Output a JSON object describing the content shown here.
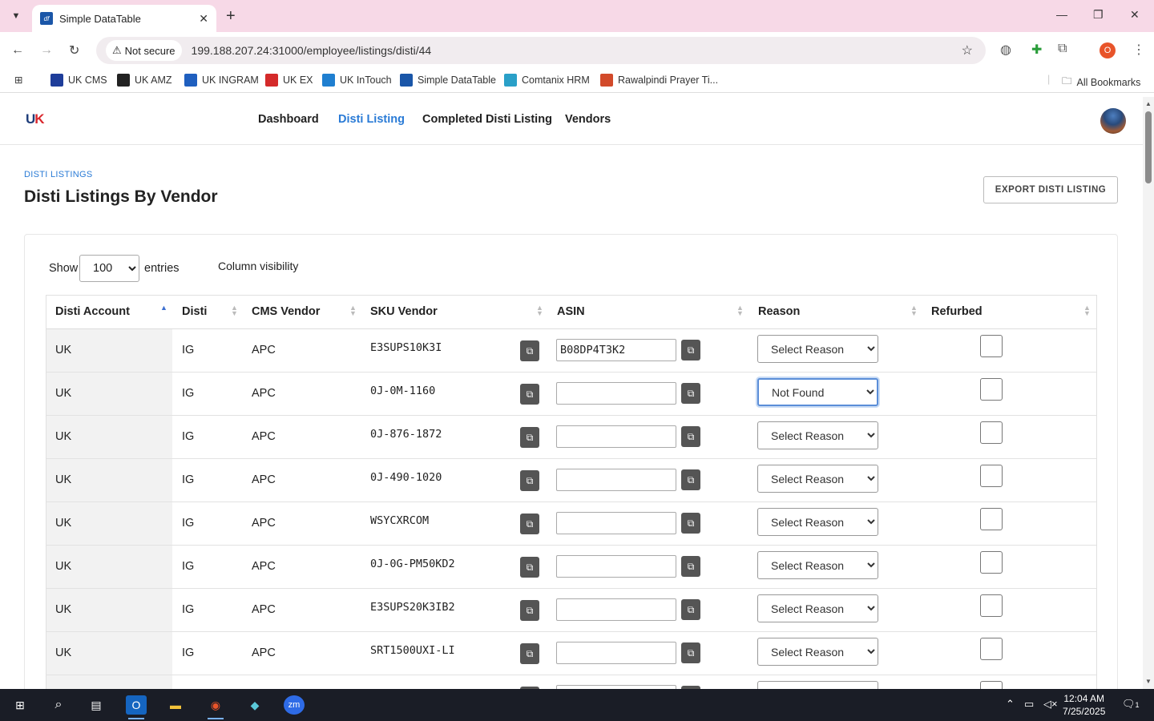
{
  "browser": {
    "tab_title": "Simple DataTable",
    "tab_favicon": "df",
    "security_label": "Not secure",
    "url": "199.188.207.24:31000/employee/listings/disti/44",
    "profile_initial": "O",
    "bookmarks": [
      {
        "label": "UK CMS",
        "color": "#1e3d9a",
        "icon": "uk-cms-icon"
      },
      {
        "label": "UK AMZ",
        "color": "#222222",
        "icon": "amazon-icon"
      },
      {
        "label": "UK INGRAM",
        "color": "#1f5fbf",
        "icon": "ingram-icon"
      },
      {
        "label": "UK EX",
        "color": "#d42a2a",
        "icon": "ex-icon"
      },
      {
        "label": "UK InTouch",
        "color": "#1f7fd0",
        "icon": "intouch-icon"
      },
      {
        "label": "Simple DataTable",
        "color": "#1a56a8",
        "icon": "datatable-icon"
      },
      {
        "label": "Comtanix HRM",
        "color": "#2aa0c8",
        "icon": "hrm-icon"
      },
      {
        "label": "Rawalpindi Prayer Ti...",
        "color": "#d24a2a",
        "icon": "prayer-icon"
      }
    ],
    "all_bookmarks": "All Bookmarks"
  },
  "nav": {
    "logo_left": "U",
    "logo_right": "K",
    "links": [
      "Dashboard",
      "Disti Listing",
      "Completed Disti Listing",
      "Vendors"
    ],
    "active": "Disti Listing"
  },
  "header": {
    "breadcrumb": "DISTI LISTINGS",
    "title": "Disti Listings By Vendor",
    "export_label": "EXPORT DISTI LISTING"
  },
  "controls": {
    "show_label": "Show",
    "entries_value": "100",
    "entries_label": "entries",
    "column_visibility": "Column visibility"
  },
  "table": {
    "headers": [
      "Disti Account",
      "Disti",
      "CMS Vendor",
      "SKU Vendor",
      "ASIN",
      "Reason",
      "Refurbed"
    ],
    "rows": [
      {
        "account": "UK",
        "disti": "IG",
        "vendor": "APC",
        "sku": "E3SUPS10K3I",
        "asin": "B08DP4T3K2",
        "reason": "Select Reason",
        "refurbed": false
      },
      {
        "account": "UK",
        "disti": "IG",
        "vendor": "APC",
        "sku": "0J-0M-1160",
        "asin": "",
        "reason": "Not Found",
        "refurbed": false
      },
      {
        "account": "UK",
        "disti": "IG",
        "vendor": "APC",
        "sku": "0J-876-1872",
        "asin": "",
        "reason": "Select Reason",
        "refurbed": false
      },
      {
        "account": "UK",
        "disti": "IG",
        "vendor": "APC",
        "sku": "0J-490-1020",
        "asin": "",
        "reason": "Select Reason",
        "refurbed": false
      },
      {
        "account": "UK",
        "disti": "IG",
        "vendor": "APC",
        "sku": "WSYCXRCOM",
        "asin": "",
        "reason": "Select Reason",
        "refurbed": false
      },
      {
        "account": "UK",
        "disti": "IG",
        "vendor": "APC",
        "sku": "0J-0G-PM50KD2",
        "asin": "",
        "reason": "Select Reason",
        "refurbed": false
      },
      {
        "account": "UK",
        "disti": "IG",
        "vendor": "APC",
        "sku": "E3SUPS20K3IB2",
        "asin": "",
        "reason": "Select Reason",
        "refurbed": false
      },
      {
        "account": "UK",
        "disti": "IG",
        "vendor": "APC",
        "sku": "SRT1500UXI-LI",
        "asin": "",
        "reason": "Select Reason",
        "refurbed": false
      },
      {
        "account": "",
        "disti": "",
        "vendor": "",
        "sku": "",
        "asin": "",
        "reason": "",
        "refurbed": false
      }
    ]
  },
  "taskbar": {
    "time": "12:04 AM",
    "date": "7/25/2025",
    "notifications": "1"
  }
}
